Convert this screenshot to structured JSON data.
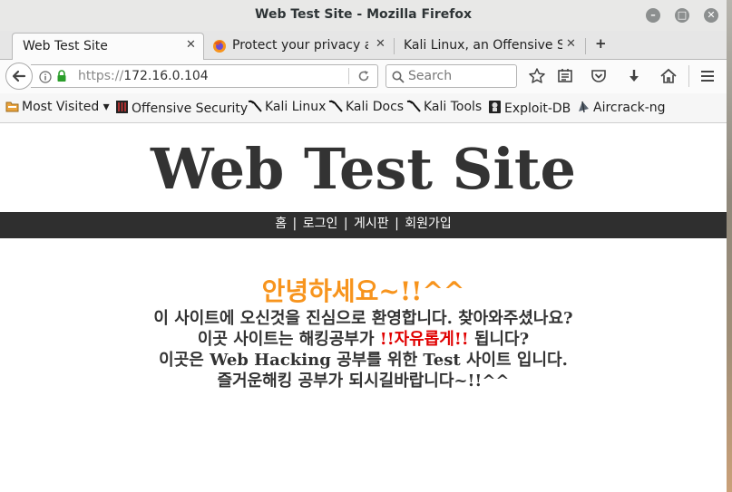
{
  "window": {
    "title": "Web Test Site - Mozilla Firefox"
  },
  "tabs": [
    {
      "label": "Web Test Site",
      "close": "✕"
    },
    {
      "label": "Protect your privacy a...",
      "close": "✕"
    },
    {
      "label": "Kali Linux, an Offensive S...",
      "close": "✕"
    }
  ],
  "new_tab_label": "+",
  "navbar": {
    "url_protocol": "https://",
    "url_host": "172.16.0.104",
    "search_placeholder": "Search"
  },
  "bookmarks": [
    {
      "label": "Most Visited ▾",
      "icon": "folder-icon"
    },
    {
      "label": "Offensive Security",
      "icon": "offsec-icon"
    },
    {
      "label": "Kali Linux",
      "icon": "kali-icon"
    },
    {
      "label": "Kali Docs",
      "icon": "kali-icon"
    },
    {
      "label": "Kali Tools",
      "icon": "kali-icon"
    },
    {
      "label": "Exploit-DB",
      "icon": "exploit-db-icon"
    },
    {
      "label": "Aircrack-ng",
      "icon": "aircrack-icon"
    }
  ],
  "site": {
    "title": "Web Test Site",
    "menu": {
      "item1": "홈",
      "item2": "로그인",
      "item3": "게시판",
      "item4": "회원가입",
      "separator": "|"
    },
    "greeting": "안녕하세요~!!^^",
    "line1": "이 사이트에 오신것을 진심으로 환영합니다. 찾아와주셨나요?",
    "line2a": "이곳 사이트는 해킹공부가",
    "line2b": "!!자유롭게!!",
    "line2c": "됩니다?",
    "line3a": "이곳은",
    "line3b": "Web Hacking",
    "line3c": "공부를 위한",
    "line3d": "Test",
    "line3e": "사이트 입니다.",
    "line4": "즐거운해킹 공부가 되시길바랍니다~!!^^"
  },
  "colors": {
    "accent": "#f7941d",
    "menu_bg": "#2f2f2f",
    "red": "#e00000"
  }
}
